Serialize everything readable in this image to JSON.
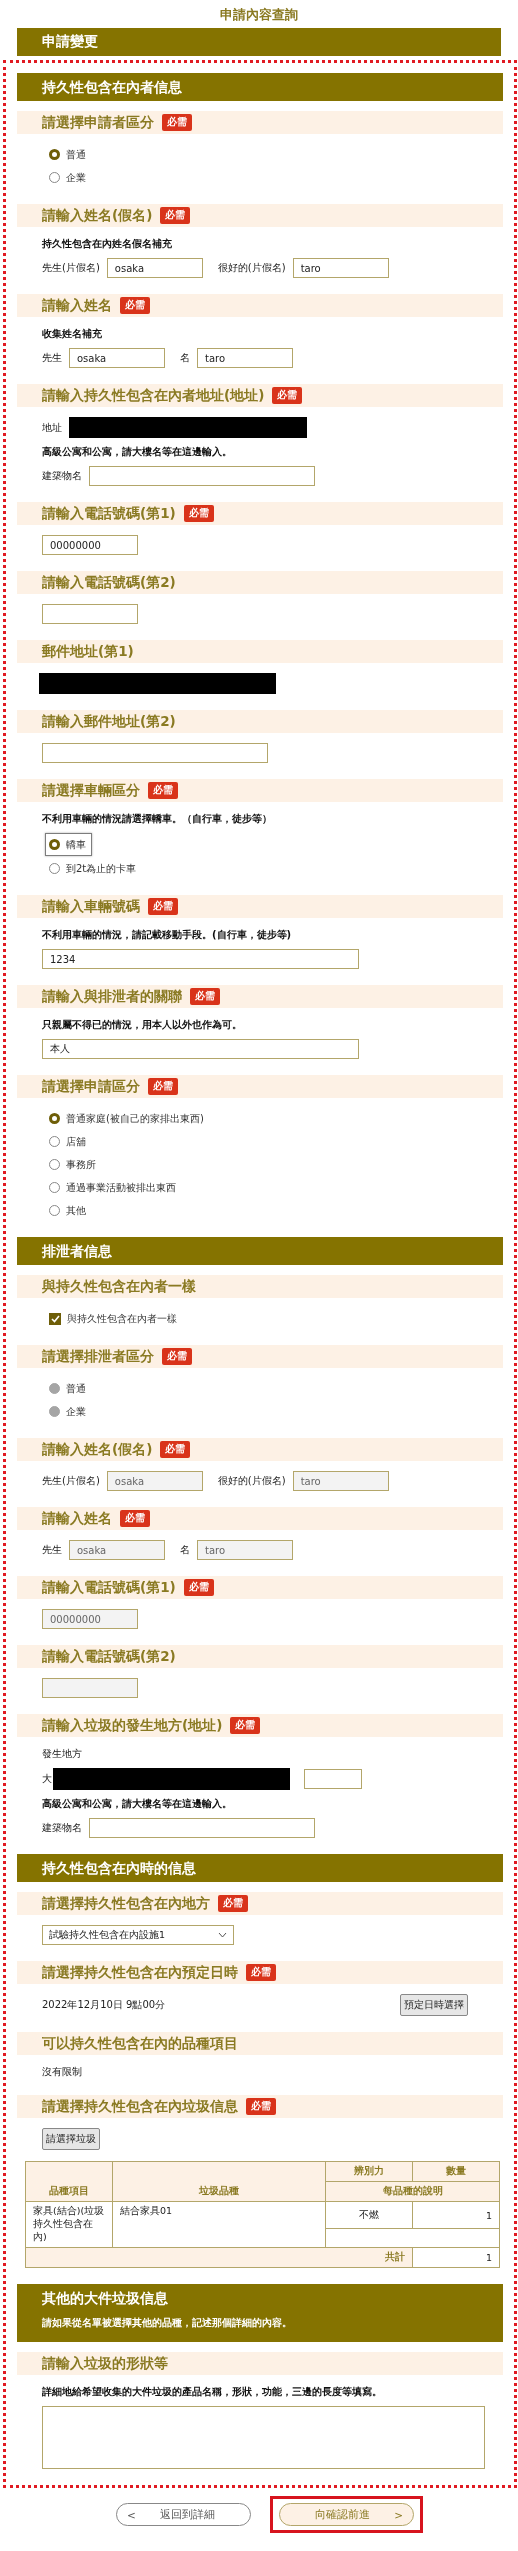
{
  "page_title": "申請內容查詢",
  "banner": "申請變更",
  "sections": [
    {
      "title": "持久性包含在內者信息",
      "fields": [
        {
          "kind": "radio",
          "label": "請選擇申請者區分",
          "badge": "必需",
          "disabled": false,
          "options": [
            {
              "label": "普通",
              "selected": true
            },
            {
              "label": "企業",
              "selected": false
            }
          ]
        },
        {
          "kind": "name_pair",
          "label": "請輸入姓名(假名)",
          "badge": "必需",
          "hint": "持久性包含在內姓名假名補充",
          "disabled": false,
          "parts": [
            {
              "label": "先生(片假名)",
              "value": "osaka"
            },
            {
              "label": "很好的(片假名)",
              "value": "taro"
            }
          ]
        },
        {
          "kind": "name_pair",
          "label": "請輸入姓名",
          "badge": "必需",
          "hint": "收集姓名補充",
          "disabled": false,
          "parts": [
            {
              "label": "先生",
              "value": "osaka"
            },
            {
              "label": "名",
              "value": "taro"
            }
          ]
        },
        {
          "kind": "address",
          "label": "請輸入持久性包含在內者地址(地址)",
          "badge": "必需",
          "address_label": "地址",
          "hint": "高級公寓和公寓，請大樓名等在這邊輸入。",
          "building_label": "建築物名"
        },
        {
          "kind": "shortfield",
          "label": "請輸入電話號碼(第1)",
          "badge": "必需",
          "disabled": false,
          "value": "00000000"
        },
        {
          "kind": "shortfield",
          "label": "請輸入電話號碼(第2)",
          "disabled": false
        },
        {
          "kind": "redacted",
          "label": "郵件地址(第1)"
        },
        {
          "kind": "mediumfield",
          "label": "請輸入郵件地址(第2)",
          "disabled": false
        },
        {
          "kind": "radio",
          "label": "請選擇車輛區分",
          "badge": "必需",
          "hint": "不利用車輛的情況請選擇轎車。（自行車，徒步等）",
          "disabled": false,
          "options": [
            {
              "label": "轎車",
              "selected": true,
              "focused": true
            },
            {
              "label": "到2t為止的卡車",
              "selected": false,
              "focused": false
            }
          ]
        },
        {
          "kind": "longfield",
          "label": "請輸入車輛號碼",
          "badge": "必需",
          "hint": "不利用車輛的情況，請記載移動手段。(自行車，徒步等)",
          "disabled": false,
          "value": "1234"
        },
        {
          "kind": "longfield",
          "label": "請輸入與排泄者的關聯",
          "badge": "必需",
          "hint": "只親屬不得已的情況，用本人以外也作為可。",
          "disabled": false,
          "value": "本人"
        },
        {
          "kind": "radio",
          "label": "請選擇申請區分",
          "badge": "必需",
          "disabled": false,
          "options": [
            {
              "label": "普通家庭(被自己的家排出東西)",
              "selected": true
            },
            {
              "label": "店舖",
              "selected": false
            },
            {
              "label": "事務所",
              "selected": false
            },
            {
              "label": "通過事業活動被排出東西",
              "selected": false
            },
            {
              "label": "其他",
              "selected": false
            }
          ]
        }
      ]
    },
    {
      "title": "排泄者信息",
      "fields": [
        {
          "kind": "checkbox",
          "label": "與持久性包含在內者一樣",
          "options": [
            {
              "label": "與持久性包含在內者一樣",
              "checked": true
            }
          ]
        },
        {
          "kind": "radio",
          "label": "請選擇排泄者區分",
          "badge": "必需",
          "disabled": true,
          "options": [
            {
              "label": "普通",
              "selected": false
            },
            {
              "label": "企業",
              "selected": false
            }
          ]
        },
        {
          "kind": "name_pair",
          "label": "請輸入姓名(假名)",
          "badge": "必需",
          "disabled": true,
          "parts": [
            {
              "label": "先生(片假名)",
              "value": "osaka"
            },
            {
              "label": "很好的(片假名)",
              "value": "taro"
            }
          ]
        },
        {
          "kind": "name_pair",
          "label": "請輸入姓名",
          "badge": "必需",
          "disabled": true,
          "parts": [
            {
              "label": "先生",
              "value": "osaka"
            },
            {
              "label": "名",
              "value": "taro"
            }
          ]
        },
        {
          "kind": "shortfield",
          "label": "請輸入電話號碼(第1)",
          "badge": "必需",
          "disabled": true,
          "value": "00000000"
        },
        {
          "kind": "shortfield",
          "label": "請輸入電話號碼(第2)",
          "disabled": true
        },
        {
          "kind": "place",
          "label": "請輸入垃圾的發生地方(地址)",
          "badge": "必需",
          "place_label": "發生地方",
          "place_prefix": "大",
          "hint": "高級公寓和公寓，請大樓名等在這邊輸入。",
          "building_label": "建築物名"
        }
      ]
    },
    {
      "title": "持久性包含在內時的信息",
      "fields": [
        {
          "kind": "select",
          "label": "請選擇持久性包含在內地方",
          "badge": "必需",
          "value": "試驗持久性包含在內設施1"
        },
        {
          "kind": "datetime",
          "label": "請選擇持久性包含在內預定日時",
          "badge": "必需",
          "value": "2022年12月10日 9點00分",
          "button": "預定日時選擇"
        },
        {
          "kind": "plain",
          "label": "可以持久性包含在內的品種項目",
          "value": "沒有限制"
        },
        {
          "kind": "table",
          "label": "請選擇持久性包含在內垃圾信息",
          "badge": "必需",
          "button": "請選擇垃圾",
          "columns": {
            "item": "品種項目",
            "name": "垃圾品種",
            "type": "辨別力",
            "quantity": "數量",
            "description": "每品種的說明"
          },
          "rows": [
            {
              "item": "家具(結合)(垃圾持久性包含在內)",
              "name": "結合家具01",
              "type": "不燃",
              "quantity": "1"
            }
          ],
          "total_label": "共計",
          "total": "1"
        }
      ]
    },
    {
      "title": "其他的大件垃圾信息",
      "note": "請如果從名單被選擇其他的品種，記述那個詳細的內容。",
      "fields": [
        {
          "kind": "textarea",
          "label": "請輸入垃圾的形狀等",
          "hint": "詳細地給希望收集的大件垃圾的產品名稱，形狀，功能，三邊的長度等填寫。"
        }
      ]
    }
  ],
  "buttons": [
    {
      "kind": "back",
      "arrow": "<",
      "label": "返回到詳細",
      "highlighted": false
    },
    {
      "kind": "next",
      "arrow": ">",
      "label": "向確認前進",
      "highlighted": true
    }
  ]
}
